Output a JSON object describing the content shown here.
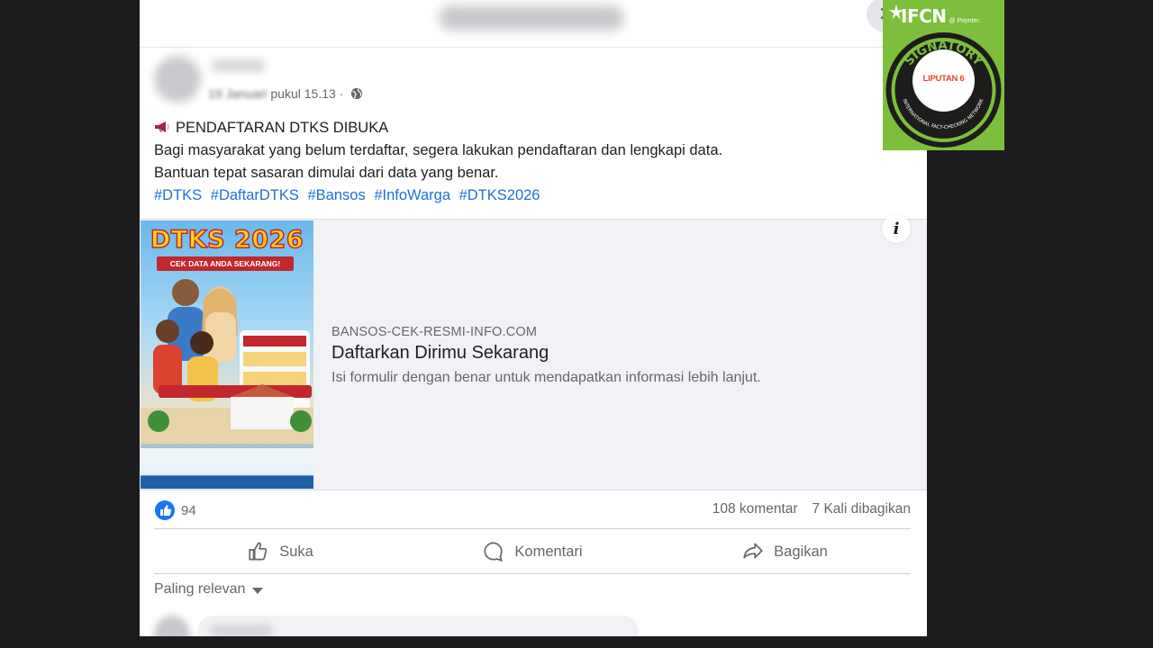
{
  "post": {
    "meta_time": "pukul 15.13 ·",
    "blurred_date": "19 Januari",
    "title_line": "PENDAFTARAN DTKS DIBUKA",
    "body_lines": [
      "Bagi masyarakat yang belum terdaftar, segera lakukan pendaftaran dan lengkapi data.",
      "Bantuan tepat sasaran dimulai dari data yang benar."
    ],
    "hashtags": [
      "#DTKS",
      "#DaftarDTKS",
      "#Bansos",
      "#InfoWarga",
      "#DTKS2026"
    ]
  },
  "ad": {
    "image_title": "DTKS 2026",
    "image_ribbon": "CEK DATA ANDA SEKARANG!",
    "domain": "BANSOS-CEK-RESMI-INFO.COM",
    "headline": "Daftarkan Dirimu Sekarang",
    "description": "Isi formulir dengan benar untuk mendapatkan informasi lebih lanjut.",
    "info_icon": "i"
  },
  "engagement": {
    "reaction_count": "94",
    "comments": "108 komentar",
    "shares": "7 Kali dibagikan"
  },
  "actions": {
    "like": "Suka",
    "comment": "Komentari",
    "share": "Bagikan"
  },
  "comments_sort": "Paling relevan",
  "badge": {
    "ifcn": "IFCN",
    "poynter": "@ Poynter.",
    "signatory_text": "SIGNATORY",
    "network_text": "INTERNATIONAL FACT-CHECKING NETWORK",
    "logo_text": "LIPUTAN 6"
  },
  "colors": {
    "link_blue": "#216fdb",
    "ifcn_green": "#7dbf3c",
    "like_blue": "#1877f2"
  }
}
